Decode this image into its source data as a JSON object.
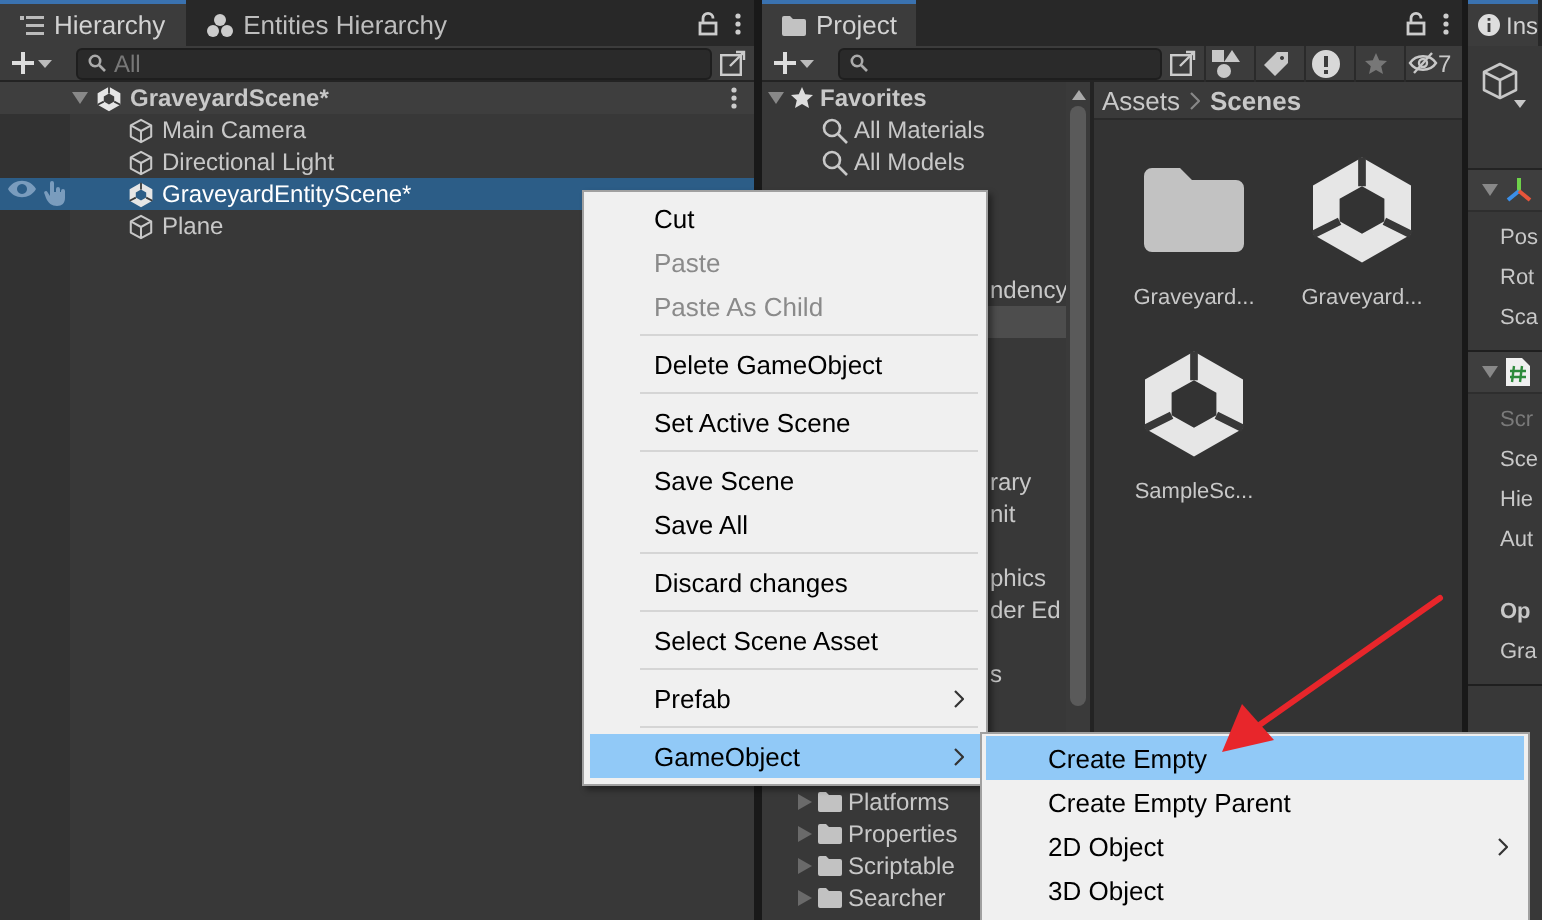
{
  "hierarchy": {
    "tabs": [
      {
        "label": "Hierarchy",
        "selected": true
      },
      {
        "label": "Entities Hierarchy",
        "selected": false
      }
    ],
    "search": {
      "placeholder": "All"
    },
    "scene": {
      "label": "GraveyardScene*",
      "expanded": true,
      "children": [
        {
          "label": "Main Camera",
          "kind": "object",
          "selected": false
        },
        {
          "label": "Directional Light",
          "kind": "object",
          "selected": false
        },
        {
          "label": "GraveyardEntityScene*",
          "kind": "scene",
          "selected": true
        },
        {
          "label": "Plane",
          "kind": "object",
          "selected": false
        }
      ]
    }
  },
  "project": {
    "tabs": [
      {
        "label": "Project",
        "selected": true
      }
    ],
    "hidden_count": "7",
    "tree": [
      {
        "label": "Favorites",
        "kind": "header",
        "selected": false
      },
      {
        "label": "All Materials",
        "kind": "search",
        "selected": false
      },
      {
        "label": "All Models",
        "kind": "search",
        "selected": false
      },
      {
        "label": "ndency",
        "kind": "fragment",
        "selected": false
      },
      {
        "kind": "fragment",
        "selected": true
      },
      {
        "label": "rary",
        "kind": "fragment",
        "selected": false
      },
      {
        "label": "nit",
        "kind": "fragment",
        "selected": false
      },
      {
        "label": "phics",
        "kind": "fragment",
        "selected": false
      },
      {
        "label": "der Ed",
        "kind": "fragment",
        "selected": false
      },
      {
        "label": "s",
        "kind": "fragment",
        "selected": false
      },
      {
        "label": "Platforms",
        "kind": "folder",
        "selected": false
      },
      {
        "label": "Properties",
        "kind": "folder",
        "selected": false
      },
      {
        "label": "Scriptable",
        "kind": "folder",
        "selected": false
      },
      {
        "label": "Searcher",
        "kind": "folder",
        "selected": false
      }
    ],
    "breadcrumb": [
      "Assets",
      "Scenes"
    ],
    "assets": [
      {
        "label": "Graveyard...",
        "kind": "folder"
      },
      {
        "label": "Graveyard...",
        "kind": "scene"
      },
      {
        "label": "SampleSc...",
        "kind": "scene"
      }
    ]
  },
  "inspector": {
    "tab": "Ins",
    "components": [
      {
        "kind": "transform",
        "expanded": true,
        "fields": [
          {
            "label": "Pos",
            "kind": "normal"
          },
          {
            "label": "Rot",
            "kind": "normal"
          },
          {
            "label": "Sca",
            "kind": "normal"
          }
        ]
      },
      {
        "kind": "script",
        "expanded": true,
        "fields": [
          {
            "label": "Scr",
            "kind": "disabled"
          },
          {
            "label": "Sce",
            "kind": "normal"
          },
          {
            "label": "Hie",
            "kind": "normal"
          },
          {
            "label": "Aut",
            "kind": "normal"
          },
          {
            "label": "Op",
            "kind": "heading"
          },
          {
            "label": "Gra",
            "kind": "normal"
          }
        ]
      }
    ]
  },
  "context_menu": {
    "groups": [
      [
        {
          "label": "Cut",
          "disabled": false,
          "submenu": false,
          "selected": false
        },
        {
          "label": "Paste",
          "disabled": true,
          "submenu": false,
          "selected": false
        },
        {
          "label": "Paste As Child",
          "disabled": true,
          "submenu": false,
          "selected": false
        }
      ],
      [
        {
          "label": "Delete GameObject",
          "disabled": false,
          "submenu": false,
          "selected": false
        }
      ],
      [
        {
          "label": "Set Active Scene",
          "disabled": false,
          "submenu": false,
          "selected": false
        }
      ],
      [
        {
          "label": "Save Scene",
          "disabled": false,
          "submenu": false,
          "selected": false
        },
        {
          "label": "Save All",
          "disabled": false,
          "submenu": false,
          "selected": false
        }
      ],
      [
        {
          "label": "Discard changes",
          "disabled": false,
          "submenu": false,
          "selected": false
        }
      ],
      [
        {
          "label": "Select Scene Asset",
          "disabled": false,
          "submenu": false,
          "selected": false
        }
      ],
      [
        {
          "label": "Prefab",
          "disabled": false,
          "submenu": true,
          "selected": false
        }
      ],
      [
        {
          "label": "GameObject",
          "disabled": false,
          "submenu": true,
          "selected": true
        }
      ]
    ]
  },
  "submenu": {
    "items": [
      {
        "label": "Create Empty",
        "submenu": false,
        "selected": true
      },
      {
        "label": "Create Empty Parent",
        "submenu": false,
        "selected": false
      },
      {
        "label": "2D Object",
        "submenu": true,
        "selected": false
      },
      {
        "label": "3D Object",
        "submenu": false,
        "selected": false
      }
    ]
  }
}
